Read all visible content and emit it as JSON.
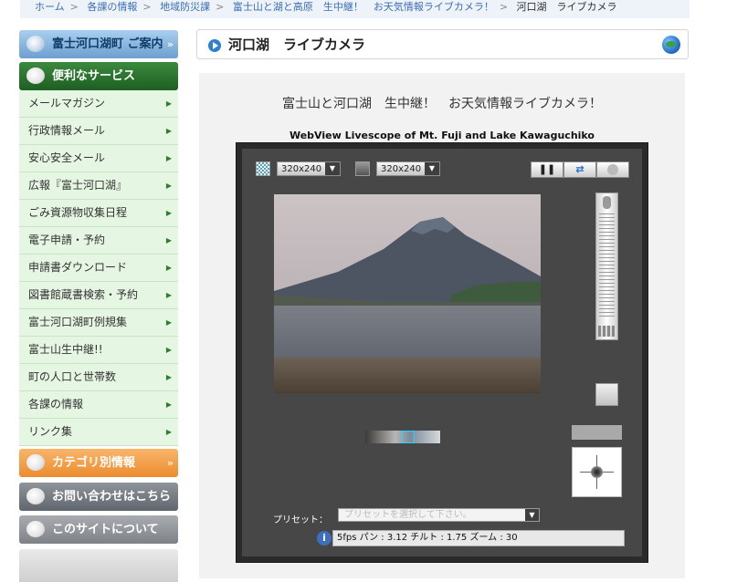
{
  "breadcrumb": {
    "items": [
      "ホーム",
      "各課の情報",
      "地域防災課",
      "富士山と湖と高原　生中継！　お天気情報ライブカメラ！"
    ],
    "separator": ">",
    "current": "河口湖　ライブカメラ"
  },
  "sidebar": {
    "town_guide": "富士河口湖町 ご案内",
    "services_title": "便利なサービス",
    "items": [
      {
        "label": "メールマガジン"
      },
      {
        "label": "行政情報メール"
      },
      {
        "label": "安心安全メール"
      },
      {
        "label": "広報『富士河口湖』"
      },
      {
        "label": "ごみ資源物収集日程"
      },
      {
        "label": "電子申請・予約"
      },
      {
        "label": "申請書ダウンロード"
      },
      {
        "label": "図書館蔵書検索・予約"
      },
      {
        "label": "富士河口湖町例規集"
      },
      {
        "label": "富士山生中継!!"
      },
      {
        "label": "町の人口と世帯数"
      },
      {
        "label": "各課の情報"
      },
      {
        "label": "リンク集"
      }
    ],
    "category": "カテゴリ別情報",
    "contact": "お問い合わせはこちら",
    "about": "このサイトについて",
    "chevron": "»"
  },
  "main": {
    "title": "河口湖　ライブカメラ",
    "lead": "富士山と河口湖　生中継！　お天気情報ライブカメラ！",
    "subtitle": "WebView Livescope of Mt. Fuji and Lake Kawaguchiko"
  },
  "viewer": {
    "size_1": "320x240",
    "size_2": "320x240",
    "pause_glyph": "❚❚",
    "swap_glyph": "⇄",
    "preset_label": "プリセット：",
    "preset_placeholder": "プリセットを選択して下さい。",
    "status": "5fps パン : 3.12 チルト : 1.75 ズーム : 30",
    "info_glyph": "i"
  },
  "colors": {
    "services_green": "#2a6f2e",
    "menu_bg": "#e5f6e2",
    "category_orange": "#f0953a",
    "link_blue": "#3a6fb5"
  }
}
